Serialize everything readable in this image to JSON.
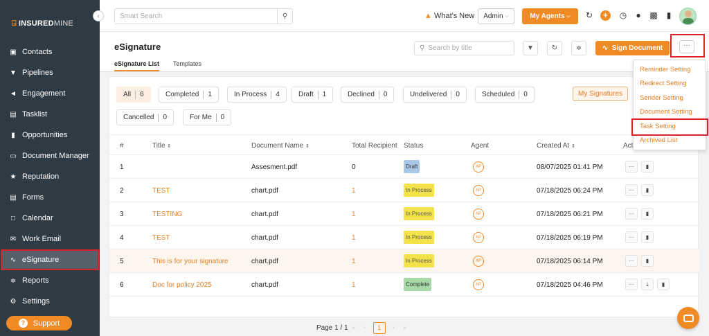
{
  "brand": {
    "logo_bold": "INSURED",
    "logo_light": "MINE",
    "accent": "#f08a24"
  },
  "sidebar": {
    "items": [
      {
        "label": "Contacts",
        "icon": "contacts-icon"
      },
      {
        "label": "Pipelines",
        "icon": "funnel-icon"
      },
      {
        "label": "Engagement",
        "icon": "megaphone-icon"
      },
      {
        "label": "Tasklist",
        "icon": "tasklist-icon"
      },
      {
        "label": "Opportunities",
        "icon": "bar-chart-icon"
      },
      {
        "label": "Document Manager",
        "icon": "folder-icon"
      },
      {
        "label": "Reputation",
        "icon": "reputation-icon"
      },
      {
        "label": "Forms",
        "icon": "form-icon"
      },
      {
        "label": "Calendar",
        "icon": "calendar-icon"
      },
      {
        "label": "Work Email",
        "icon": "mail-icon"
      },
      {
        "label": "eSignature",
        "icon": "signature-icon",
        "active": true
      },
      {
        "label": "Reports",
        "icon": "line-chart-icon"
      },
      {
        "label": "Settings",
        "icon": "gear-icon"
      }
    ],
    "support_label": "Support"
  },
  "topbar": {
    "search_placeholder": "Smart Search",
    "whats_new": "What's New",
    "admin_label": "Admin",
    "my_agents_label": "My Agents"
  },
  "page": {
    "title": "eSignature",
    "tabs": [
      "eSignature List",
      "Templates"
    ],
    "search_placeholder": "Search by title",
    "sign_document_label": "Sign Document",
    "more_label": "···"
  },
  "filters": [
    {
      "label": "All",
      "count": "6",
      "active": true
    },
    {
      "label": "Completed",
      "count": "1"
    },
    {
      "label": "In Process",
      "count": "4"
    },
    {
      "label": "Draft",
      "count": "1"
    },
    {
      "label": "Declined",
      "count": "0"
    },
    {
      "label": "Undelivered",
      "count": "0"
    },
    {
      "label": "Scheduled",
      "count": "0"
    },
    {
      "label": "Cancelled",
      "count": "0"
    },
    {
      "label": "For Me",
      "count": "0"
    }
  ],
  "my_signatures_label": "My Signatures",
  "table": {
    "headers": [
      "#",
      "Title",
      "Document Name",
      "Total Recipient",
      "Status",
      "Agent",
      "Created At",
      "Act"
    ],
    "rows": [
      {
        "num": "1",
        "title": "",
        "doc": "Assesment.pdf",
        "recipients": "0",
        "status": "Draft",
        "agent": "AP",
        "created": "08/07/2025 01:41 PM"
      },
      {
        "num": "2",
        "title": "TEST",
        "doc": "chart.pdf",
        "recipients": "1",
        "status": "In Process",
        "agent": "AP",
        "created": "07/18/2025 06:24 PM"
      },
      {
        "num": "3",
        "title": "TESTING",
        "doc": "chart.pdf",
        "recipients": "1",
        "status": "In Process",
        "agent": "AP",
        "created": "07/18/2025 06:21 PM"
      },
      {
        "num": "4",
        "title": "TEST",
        "doc": "chart.pdf",
        "recipients": "1",
        "status": "In Process",
        "agent": "AP",
        "created": "07/18/2025 06:19 PM"
      },
      {
        "num": "5",
        "title": "This is for your signature",
        "doc": "chart.pdf",
        "recipients": "1",
        "status": "In Process",
        "agent": "AP",
        "created": "07/18/2025 06:14 PM"
      },
      {
        "num": "6",
        "title": "Doc for policy 2025",
        "doc": "chart.pdf",
        "recipients": "1",
        "status": "Complete",
        "agent": "AP",
        "created": "07/18/2025 04:46 PM"
      }
    ]
  },
  "pager": {
    "text": "Page 1 / 1",
    "current": "1"
  },
  "dropdown": {
    "items": [
      "Reminder Setting",
      "Redirect Setting",
      "Sender Setting",
      "Document Setting",
      "Task Setting",
      "Archived List"
    ]
  }
}
